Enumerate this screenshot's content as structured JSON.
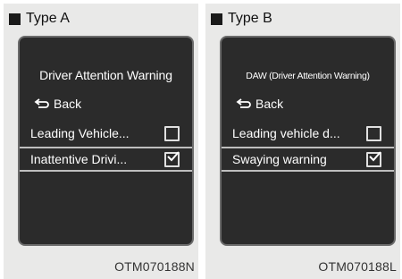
{
  "panels": [
    {
      "type_label": "Type A",
      "screen_title": "Driver Attention Warning",
      "back_label": "Back",
      "items": [
        {
          "label": "Leading Vehicle...",
          "checked": false
        },
        {
          "label": "Inattentive Drivi...",
          "checked": true
        }
      ],
      "image_code": "OTM070188N"
    },
    {
      "type_label": "Type B",
      "screen_title": "DAW (Driver Attention Warning)",
      "back_label": "Back",
      "items": [
        {
          "label": "Leading vehicle d...",
          "checked": false
        },
        {
          "label": "Swaying warning",
          "checked": true
        }
      ],
      "image_code": "OTM070188L"
    }
  ],
  "icons": {
    "type_marker": "square-bullet-icon",
    "back": "return-arrow-icon",
    "checkbox_empty": "checkbox-empty-icon",
    "checkbox_checked": "checkbox-checked-icon"
  },
  "colors": {
    "screen_background": "#2b2b2b",
    "panel_background": "#e9e9e8",
    "text_on_screen": "#ffffff",
    "selection_border": "#bfbfbf"
  }
}
